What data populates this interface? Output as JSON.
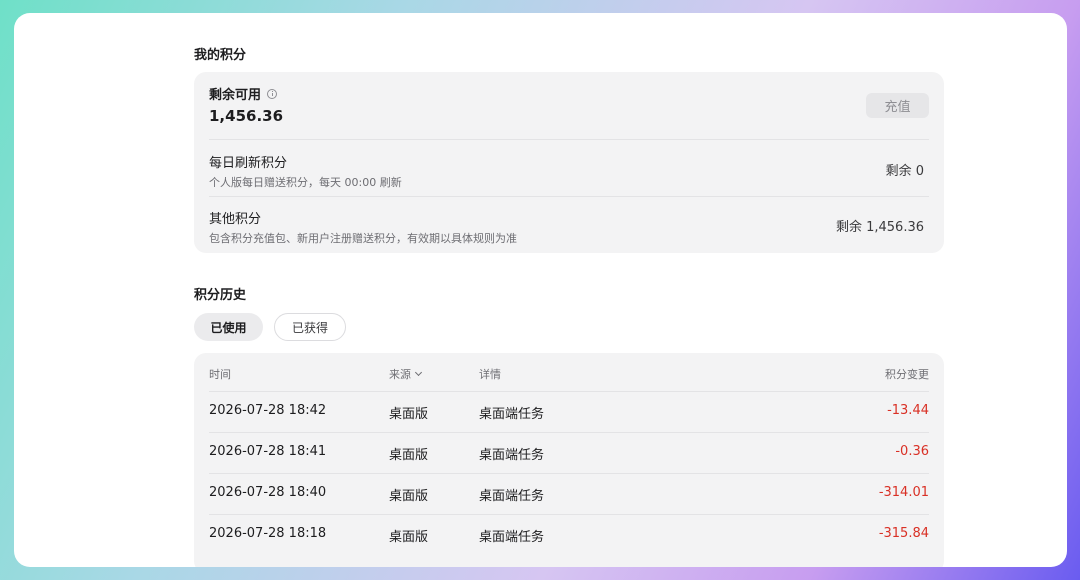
{
  "points": {
    "title": "我的积分",
    "available_label": "剩余可用",
    "available_value": "1,456.36",
    "recharge_label": "充值",
    "daily": {
      "title": "每日刷新积分",
      "desc": "个人版每日赠送积分，每天 00:00 刷新",
      "remaining": "剩余 0"
    },
    "other": {
      "title": "其他积分",
      "desc": "包含积分充值包、新用户注册赠送积分，有效期以具体规则为准",
      "remaining": "剩余 1,456.36"
    }
  },
  "history": {
    "title": "积分历史",
    "tabs": [
      {
        "label": "已使用",
        "active": true
      },
      {
        "label": "已获得",
        "active": false
      }
    ],
    "columns": {
      "time": "时间",
      "source": "来源",
      "detail": "详情",
      "change": "积分变更"
    },
    "rows": [
      {
        "time": "2026-07-28 18:42",
        "source": "桌面版",
        "detail": "桌面端任务",
        "change": "-13.44"
      },
      {
        "time": "2026-07-28 18:41",
        "source": "桌面版",
        "detail": "桌面端任务",
        "change": "-0.36"
      },
      {
        "time": "2026-07-28 18:40",
        "source": "桌面版",
        "detail": "桌面端任务",
        "change": "-314.01"
      },
      {
        "time": "2026-07-28 18:18",
        "source": "桌面版",
        "detail": "桌面端任务",
        "change": "-315.84"
      }
    ]
  },
  "colors": {
    "negative": "#d93025",
    "card_bg": "#f3f3f4"
  }
}
